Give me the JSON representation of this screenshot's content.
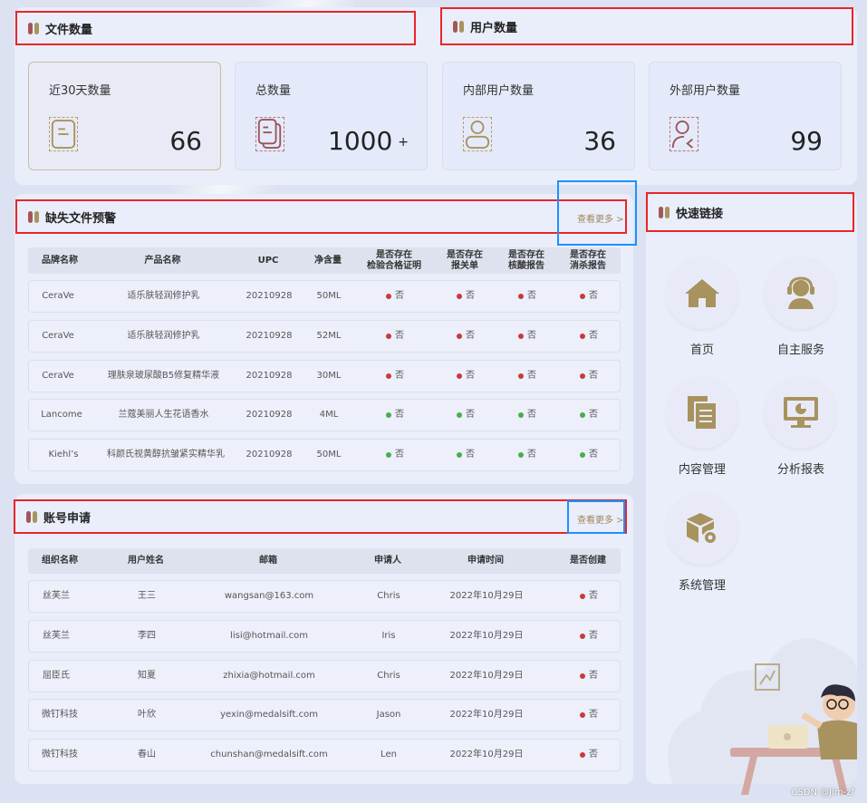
{
  "files": {
    "title": "文件数量",
    "stats": [
      {
        "label": "近30天数量",
        "value": "66",
        "suffix": ""
      },
      {
        "label": "总数量",
        "value": "1000",
        "suffix": "+"
      }
    ]
  },
  "users": {
    "title": "用户数量",
    "stats": [
      {
        "label": "内部用户数量",
        "value": "36"
      },
      {
        "label": "外部用户数量",
        "value": "99"
      }
    ]
  },
  "missing": {
    "title": "缺失文件预警",
    "more": "查看更多 >",
    "headers": [
      "品牌名称",
      "产品名称",
      "UPC",
      "净含量",
      "是否存在\n检验合格证明",
      "是否存在\n报关单",
      "是否存在\n核酸报告",
      "是否存在\n消杀报告"
    ],
    "rows": [
      {
        "brand": "CeraVe",
        "product": "适乐肤轻润修护乳",
        "upc": "20210928",
        "net": "50ML",
        "c1": "否",
        "c2": "否",
        "c3": "否",
        "c4": "否",
        "status": "red"
      },
      {
        "brand": "CeraVe",
        "product": "适乐肤轻润修护乳",
        "upc": "20210928",
        "net": "52ML",
        "c1": "否",
        "c2": "否",
        "c3": "否",
        "c4": "否",
        "status": "red"
      },
      {
        "brand": "CeraVe",
        "product": "理肤泉玻尿酸B5修复精华液",
        "upc": "20210928",
        "net": "30ML",
        "c1": "否",
        "c2": "否",
        "c3": "否",
        "c4": "否",
        "status": "red"
      },
      {
        "brand": "Lancome",
        "product": "兰蔻美丽人生花语香水",
        "upc": "20210928",
        "net": "4ML",
        "c1": "否",
        "c2": "否",
        "c3": "否",
        "c4": "否",
        "status": "green"
      },
      {
        "brand": "Kiehl’s",
        "product": "科颜氏视黄醇抗皱紧实精华乳",
        "upc": "20210928",
        "net": "50ML",
        "c1": "否",
        "c2": "否",
        "c3": "否",
        "c4": "否",
        "status": "green"
      }
    ]
  },
  "accounts": {
    "title": "账号申请",
    "more": "查看更多 >",
    "headers": [
      "组织名称",
      "用户姓名",
      "邮箱",
      "申请人",
      "申请时间",
      "是否创建"
    ],
    "rows": [
      {
        "org": "丝芙兰",
        "name": "王三",
        "email": "wangsan@163.com",
        "applicant": "Chris",
        "time": "2022年10月29日",
        "created": "否"
      },
      {
        "org": "丝芙兰",
        "name": "李四",
        "email": "lisi@hotmail.com",
        "applicant": "Iris",
        "time": "2022年10月29日",
        "created": "否"
      },
      {
        "org": "屈臣氏",
        "name": "知夏",
        "email": "zhixia@hotmail.com",
        "applicant": "Chris",
        "time": "2022年10月29日",
        "created": "否"
      },
      {
        "org": "微钉科技",
        "name": "叶欣",
        "email": "yexin@medalsift.com",
        "applicant": "Jason",
        "time": "2022年10月29日",
        "created": "否"
      },
      {
        "org": "微钉科技",
        "name": "春山",
        "email": "chunshan@medalsift.com",
        "applicant": "Len",
        "time": "2022年10月29日",
        "created": "否"
      }
    ]
  },
  "quick": {
    "title": "快速链接",
    "links": [
      {
        "label": "首页",
        "icon": "home-icon"
      },
      {
        "label": "自主服务",
        "icon": "customer-service-icon"
      },
      {
        "label": "内容管理",
        "icon": "documents-icon"
      },
      {
        "label": "分析报表",
        "icon": "monitor-chart-icon"
      },
      {
        "label": "系统管理",
        "icon": "box-gear-icon"
      }
    ]
  },
  "watermark": "CSDN @Jim-zf",
  "colors": {
    "accent": "#a8935f",
    "red_outline": "#e6262a",
    "blue_outline": "#1e90ff",
    "status_red": "#c9393e",
    "status_green": "#4aae4a"
  }
}
